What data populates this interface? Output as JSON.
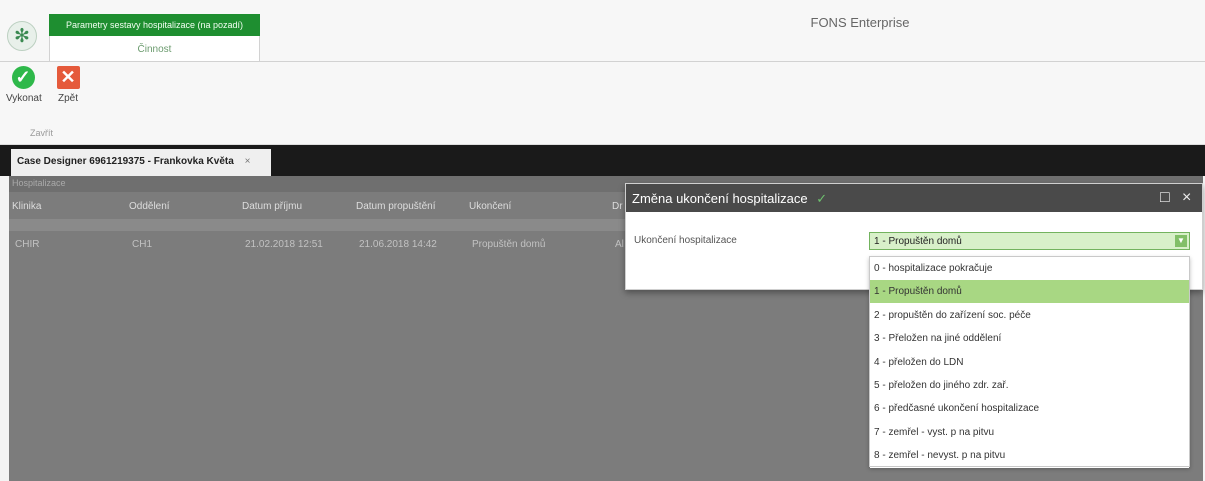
{
  "app": {
    "title": "FONS Enterprise",
    "context_tab": "Parametry sestavy hospitalizace (na pozadí)",
    "context_group": "Činnost",
    "actions": [
      {
        "label": "Vykonat",
        "icon": "check-icon"
      },
      {
        "label": "Zpět",
        "icon": "close-icon"
      }
    ],
    "action_group_label": "Zavřít"
  },
  "document_tab": {
    "title": "Case Designer 6961219375 - Frankovka Květa",
    "close_glyph": "×"
  },
  "grid": {
    "section_label": "Hospitalizace",
    "headers": [
      "Klinika",
      "Oddělení",
      "Datum příjmu",
      "Datum propuštění",
      "Ukončení",
      "Dr"
    ],
    "row": [
      "CHIR",
      "CH1",
      "21.02.2018 12:51",
      "21.06.2018 14:42",
      "Propuštěn domů",
      "Al"
    ]
  },
  "dialog": {
    "title": "Změna ukončení hospitalizace",
    "title_suffix": "✓",
    "maximize_glyph": "□",
    "close_glyph": "×",
    "field_label": "Ukončení hospitalizace",
    "selected_value": "1 - Propuštěn domů",
    "options": [
      "0 - hospitalizace pokračuje",
      "1 - Propuštěn domů",
      "2 - propuštěn do zařízení soc. péče",
      "3 - Přeložen na jiné oddělení",
      "4 - přeložen do LDN",
      "5 - přeložen do jiného zdr. zař.",
      "6 - předčasné ukončení hospitalizace",
      "7 - zemřel - vyst. p na pitvu",
      "8 - zemřel - nevyst. p na pitvu"
    ]
  },
  "colors": {
    "context_tab": "#1e8e30",
    "accept": "#2eb84a",
    "cancel": "#e55a3b",
    "selected_option": "#a8d783"
  }
}
